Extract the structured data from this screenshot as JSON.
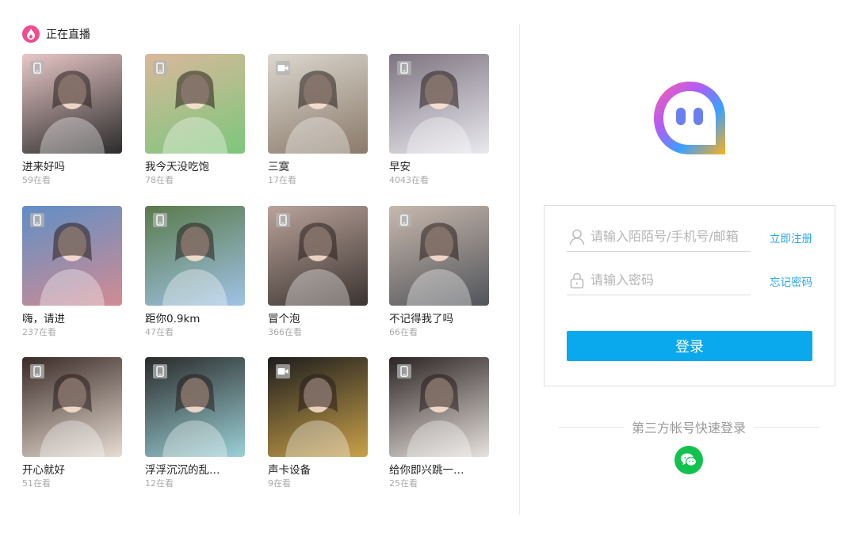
{
  "live": {
    "title": "正在直播",
    "icon": "flame-icon",
    "accent": "#ee4d8f",
    "items": [
      {
        "title": "进来好吗",
        "viewers": "59在看",
        "badge": "phone-icon",
        "bg": [
          "#2b2b2b",
          "#e9c7c7"
        ]
      },
      {
        "title": "我今天没吃饱",
        "viewers": "78在看",
        "badge": "phone-icon",
        "bg": [
          "#7cc77c",
          "#d9b89a"
        ]
      },
      {
        "title": "三寞",
        "viewers": "17在看",
        "badge": "camera-icon",
        "bg": [
          "#8a7a6a",
          "#dcd7cf"
        ]
      },
      {
        "title": "早安",
        "viewers": "4043在看",
        "badge": "phone-icon",
        "bg": [
          "#eae9ef",
          "#7d7480"
        ]
      },
      {
        "title": "嗨，请进",
        "viewers": "237在看",
        "badge": "phone-icon",
        "bg": [
          "#d28b93",
          "#5f8fc6"
        ]
      },
      {
        "title": "距你0.9km",
        "viewers": "47在看",
        "badge": "phone-icon",
        "bg": [
          "#9fc3e6",
          "#5a7a4a"
        ]
      },
      {
        "title": "冒个泡",
        "viewers": "366在看",
        "badge": "phone-icon",
        "bg": [
          "#3b3330",
          "#b9a39a"
        ]
      },
      {
        "title": "不记得我了吗",
        "viewers": "66在看",
        "badge": "phone-icon",
        "bg": [
          "#50545a",
          "#c8b8ad"
        ]
      },
      {
        "title": "开心就好",
        "viewers": "51在看",
        "badge": "phone-icon",
        "bg": [
          "#e7ddd3",
          "#3a2a26"
        ]
      },
      {
        "title": "浮浮沉沉的乱…",
        "viewers": "12在看",
        "badge": "phone-icon",
        "bg": [
          "#9ad0d6",
          "#2a2a2a"
        ]
      },
      {
        "title": "声卡设备",
        "viewers": "9在看",
        "badge": "camera-icon",
        "bg": [
          "#c9a14a",
          "#1d1d1d"
        ]
      },
      {
        "title": "给你即兴跳一…",
        "viewers": "25在看",
        "badge": "phone-icon",
        "bg": [
          "#e8e2de",
          "#2b2424"
        ]
      }
    ]
  },
  "login": {
    "logo": "momo-logo",
    "account_placeholder": "请输入陌陌号/手机号/邮箱",
    "password_placeholder": "请输入密码",
    "register_link": "立即注册",
    "forgot_link": "忘记密码",
    "login_button": "登录",
    "third_party_label": "第三方帐号快速登录",
    "accent": "#0aa8ec",
    "wechat_color": "#12c24e"
  }
}
